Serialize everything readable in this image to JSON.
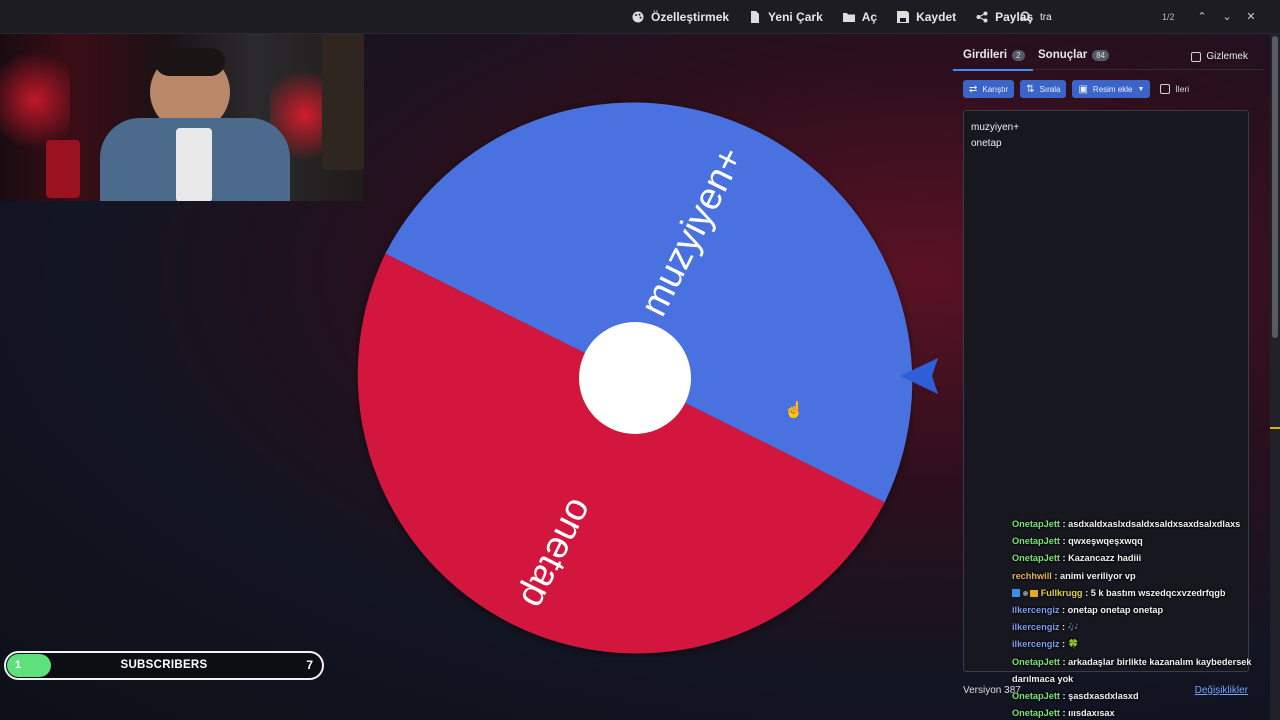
{
  "toolbar": {
    "items": [
      {
        "label": "Özelleştirmek",
        "icon": "palette-icon"
      },
      {
        "label": "Yeni Çark",
        "icon": "file-icon"
      },
      {
        "label": "Aç",
        "icon": "folder-icon"
      },
      {
        "label": "Kaydet",
        "icon": "save-icon"
      },
      {
        "label": "Paylaş",
        "icon": "share-icon"
      }
    ],
    "find": {
      "value": "tra",
      "count": "1/2"
    }
  },
  "wheel": {
    "segments": [
      {
        "label": "muzyiyen+",
        "color": "#4a72e0"
      },
      {
        "label": "onetap",
        "color": "#d2163e"
      }
    ],
    "center_color": "#ffffff",
    "pointer_color": "#2f5fd8"
  },
  "panel": {
    "tabs": [
      {
        "label": "Girdileri",
        "count": "2"
      },
      {
        "label": "Sonuçlar",
        "count": "84"
      }
    ],
    "hide_label": "Gizlemek",
    "buttons": {
      "shuffle": "Karıştır",
      "sort": "Sırala",
      "add_image": "Resim ekle",
      "advanced": "İleri"
    },
    "entries": [
      "muzyiyen+",
      "onetap"
    ],
    "version": "Versiyon 387",
    "changes": "Değişiklikler"
  },
  "chat": [
    {
      "user": "OnetapJett",
      "color": "#7ee37e",
      "msg": "asdxaldxaslxdsaldxsaldxsaxdsalxdlaxs"
    },
    {
      "user": "OnetapJett",
      "color": "#7ee37e",
      "msg": "qwxeşwqeşxwqq"
    },
    {
      "user": "OnetapJett",
      "color": "#7ee37e",
      "msg": "Kazancazz hadiii"
    },
    {
      "user": "rechhwill",
      "color": "#e6b15a",
      "msg": "animi veriliyor vp"
    },
    {
      "user": "Fullkrugg",
      "color": "#e0d24a",
      "msg": "5 k bastım wszedqcxvzedrfqgb",
      "badges": true
    },
    {
      "user": "ilkercengiz",
      "color": "#7c9cf0",
      "msg": "onetap onetap onetap"
    },
    {
      "user": "ilkercengiz",
      "color": "#7c9cf0",
      "msg": "🎶"
    },
    {
      "user": "ilkercengiz",
      "color": "#7c9cf0",
      "msg": "🍀"
    },
    {
      "user": "OnetapJett",
      "color": "#7ee37e",
      "msg": "arkadaşlar birlikte kazanalım kaybedersek darılmaca yok"
    },
    {
      "user": "OnetapJett",
      "color": "#7ee37e",
      "msg": "şasdxasdxlasxd"
    },
    {
      "user": "OnetapJett",
      "color": "#7ee37e",
      "msg": "ııısdaxısax"
    }
  ],
  "subscribers": {
    "start": "1",
    "label": "SUBSCRIBERS",
    "goal": "7",
    "progress": 0.14,
    "fill_color": "#5ee07a"
  }
}
